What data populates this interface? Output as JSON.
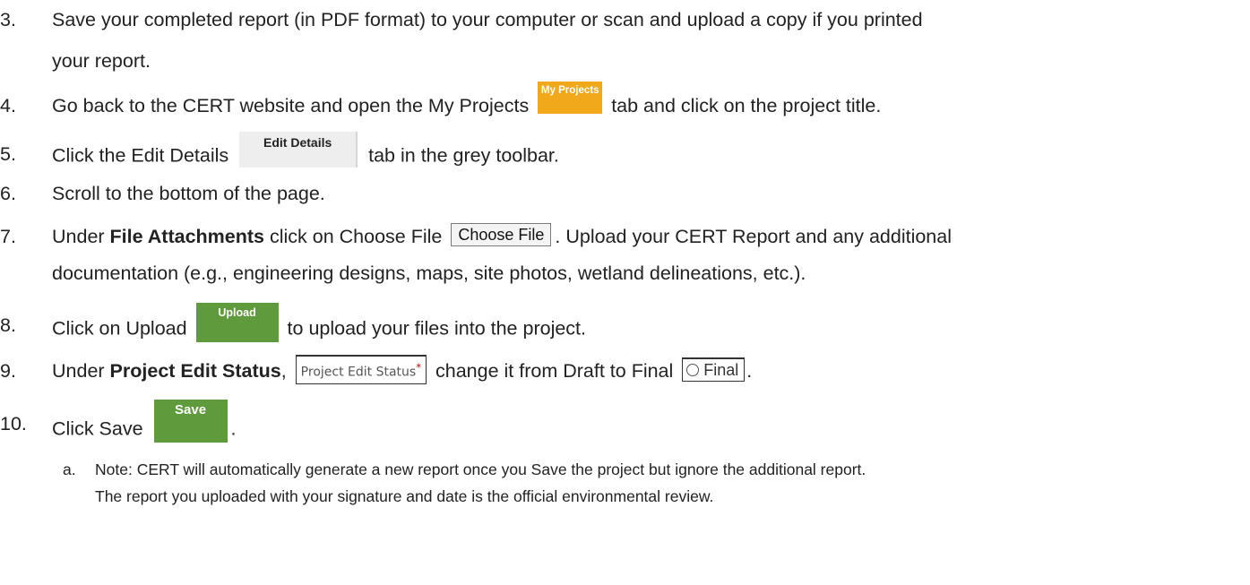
{
  "steps": [
    {
      "num": "3.",
      "line1": "Save your completed report (in PDF format) to your computer or scan and upload a copy if you printed",
      "line2": "your report."
    },
    {
      "num": "4.",
      "before": "Go back to the CERT website and open the My Projects",
      "chip": "My Projects",
      "after": "tab and click on the project title."
    },
    {
      "num": "5.",
      "before": "Click the Edit Details",
      "chip": "Edit Details",
      "after": "tab in the grey toolbar."
    },
    {
      "num": "6.",
      "text": "Scroll to the bottom of the page."
    },
    {
      "num": "7.",
      "pre": "Under",
      "bold": "File Attachments",
      "before": "click on Choose File",
      "chip": "Choose File",
      "after": ". Upload your CERT Report and any additional",
      "line2": "documentation (e.g., engineering designs, maps, site photos, wetland delineations, etc.)."
    },
    {
      "num": "8.",
      "before": "Click on Upload",
      "chip": "Upload",
      "after": "to upload your files into the project."
    },
    {
      "num": "9.",
      "pre": "Under",
      "bold": "Project Edit Status",
      "comma": ",",
      "chip": "Project Edit Status",
      "required": "*",
      "middle": "change it from Draft to Final",
      "chip2": "Final",
      "end": "."
    },
    {
      "num": "10.",
      "before": "Click Save",
      "chip": "Save",
      "end": "."
    }
  ],
  "note": {
    "letter": "a.",
    "line1": "Note: CERT will automatically generate a new report once you Save the project but ignore the additional report.",
    "line2": "The report you uploaded with your signature and date is the official environmental review."
  },
  "colors": {
    "my_projects_tab": "#f2a81b",
    "edit_details_tab": "#eeeeee",
    "upload_button": "#5f9a3d",
    "save_button": "#5f9a3d",
    "required_marker": "#cc0000"
  }
}
